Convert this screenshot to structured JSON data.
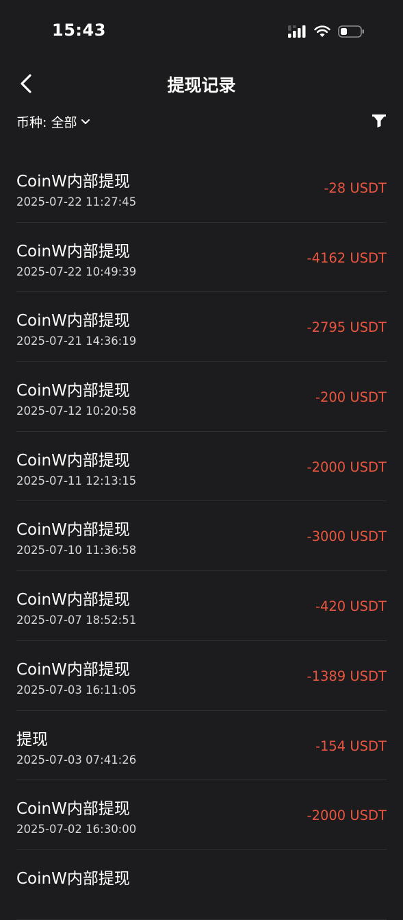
{
  "status_bar": {
    "time": "15:43",
    "icons": [
      "cellular-signal-icon",
      "wifi-icon",
      "battery-icon"
    ]
  },
  "header": {
    "title": "提现记录",
    "back_icon": "chevron-left-icon"
  },
  "filter": {
    "coin_label": "币种: 全部",
    "dropdown_icon": "chevron-down-icon",
    "filter_icon": "funnel-icon"
  },
  "records": [
    {
      "title": "CoinW内部提现",
      "time": "2025-07-22 11:27:45",
      "amount": "-28 USDT"
    },
    {
      "title": "CoinW内部提现",
      "time": "2025-07-22 10:49:39",
      "amount": "-4162 USDT"
    },
    {
      "title": "CoinW内部提现",
      "time": "2025-07-21 14:36:19",
      "amount": "-2795 USDT"
    },
    {
      "title": "CoinW内部提现",
      "time": "2025-07-12 10:20:58",
      "amount": "-200 USDT"
    },
    {
      "title": "CoinW内部提现",
      "time": "2025-07-11 12:13:15",
      "amount": "-2000 USDT"
    },
    {
      "title": "CoinW内部提现",
      "time": "2025-07-10 11:36:58",
      "amount": "-3000 USDT"
    },
    {
      "title": "CoinW内部提现",
      "time": "2025-07-07 18:52:51",
      "amount": "-420 USDT"
    },
    {
      "title": "CoinW内部提现",
      "time": "2025-07-03 16:11:05",
      "amount": "-1389 USDT"
    },
    {
      "title": "提现",
      "time": "2025-07-03 07:41:26",
      "amount": "-154 USDT"
    },
    {
      "title": "CoinW内部提现",
      "time": "2025-07-02 16:30:00",
      "amount": "-2000 USDT"
    },
    {
      "title": "CoinW内部提现",
      "time": "",
      "amount": ""
    }
  ],
  "colors": {
    "background": "#1c1c1e",
    "amount_negative": "#e8553f",
    "divider": "#2e2e31"
  }
}
